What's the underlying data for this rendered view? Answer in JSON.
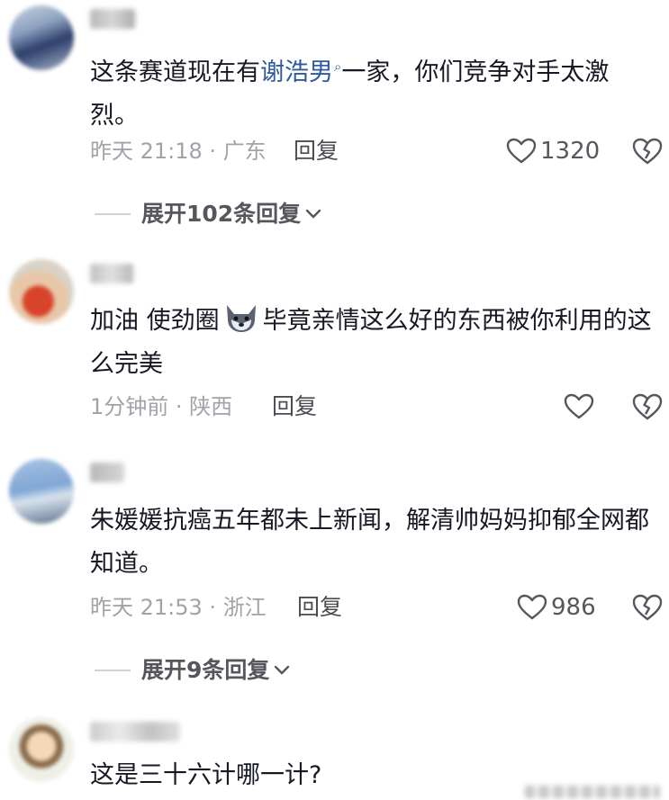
{
  "comments": [
    {
      "text_before": "这条赛道现在有",
      "mention": "谢浩男",
      "text_after": "一家，你们竞争对手太激烈。",
      "time": "昨天 21:18",
      "location": "广东",
      "reply_label": "回复",
      "likes": "1320",
      "expand_label": "展开102条回复"
    },
    {
      "text_before": "加油 使劲圈",
      "emoji": "dog-face-emoji",
      "text_after": "毕竟亲情这么好的东西被你利用的这么完美",
      "time": "1分钟前",
      "location": "陕西",
      "reply_label": "回复",
      "likes": ""
    },
    {
      "text": "朱媛媛抗癌五年都未上新闻，解清帅妈妈抑郁全网都知道。",
      "time": "昨天 21:53",
      "location": "浙江",
      "reply_label": "回复",
      "likes": "986",
      "expand_label": "展开9条回复"
    },
    {
      "text": "这是三十六计哪一计?"
    }
  ],
  "meta_separator": " · ",
  "icons": {
    "like": "heart-outline-icon",
    "dislike": "broken-heart-icon",
    "expand": "chevron-down-icon",
    "search": "search-icon"
  },
  "colors": {
    "mention": "#2f5a9e",
    "meta": "#a1a3a8",
    "text": "#161823"
  }
}
